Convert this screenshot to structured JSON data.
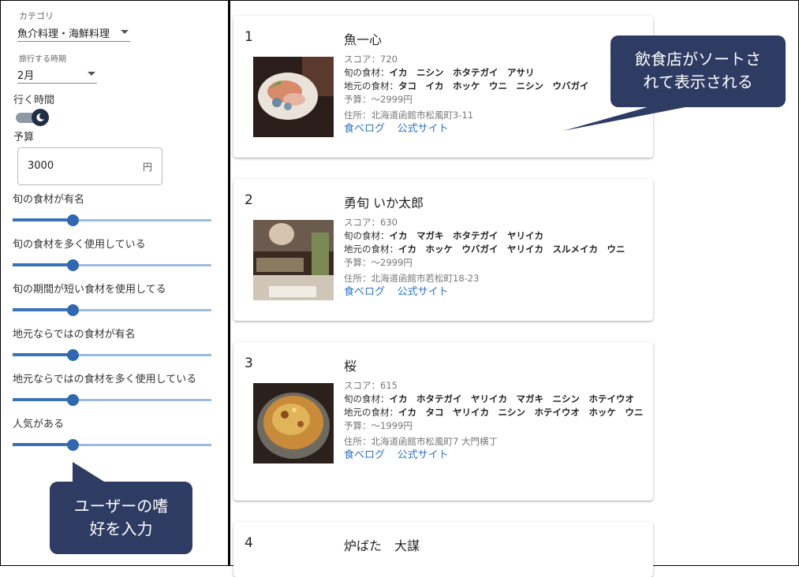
{
  "sidebar": {
    "category_label": "カテゴリ",
    "category_value": "魚介料理・海鮮料理",
    "period_label": "旅行する時期",
    "period_value": "2月",
    "time_label": "行く時間",
    "budget_label": "予算",
    "budget_value": "3000",
    "budget_unit": "円",
    "sliders": [
      {
        "label": "旬の食材が有名",
        "value": 0.3
      },
      {
        "label": "旬の食材を多く使用している",
        "value": 0.3
      },
      {
        "label": "旬の期間が短い食材を使用してる",
        "value": 0.3
      },
      {
        "label": "地元ならではの食材が有名",
        "value": 0.3
      },
      {
        "label": "地元ならではの食材を多く使用している",
        "value": 0.3
      },
      {
        "label": "人気がある",
        "value": 0.3
      }
    ]
  },
  "callouts": {
    "results": "飲食店がソートさ\nれて表示される",
    "input": "ユーザーの嗜\n好を入力"
  },
  "results": [
    {
      "rank": "1",
      "name": "魚一心",
      "score": "スコア：720",
      "seasonal_label": "旬の食材：",
      "seasonal": "イカ　ニシン　ホタテガイ　アサリ",
      "local_label": "地元の食材：",
      "local": "タコ　イカ　ホッケ　ウニ　ニシン　ウバガイ",
      "budget": "予算：～2999円",
      "address": "住所：北海道函館市松風町3-11",
      "link1": "食べログ",
      "link2": "公式サイト"
    },
    {
      "rank": "2",
      "name": "勇旬 いか太郎",
      "score": "スコア：630",
      "seasonal_label": "旬の食材：",
      "seasonal": "イカ　マガキ　ホタテガイ　ヤリイカ",
      "local_label": "地元の食材：",
      "local": "イカ　ホッケ　ウバガイ　ヤリイカ　スルメイカ　ウニ",
      "budget": "予算：～2999円",
      "address": "住所：北海道函館市若松町18-23",
      "link1": "食べログ",
      "link2": "公式サイト"
    },
    {
      "rank": "3",
      "name": "桜",
      "score": "スコア：615",
      "seasonal_label": "旬の食材：",
      "seasonal": "イカ　ホタテガイ　ヤリイカ　マガキ　ニシン　ホテイウオ",
      "local_label": "地元の食材：",
      "local": "イカ　タコ　ヤリイカ　ニシン　ホテイウオ　ホッケ　ウニ",
      "budget": "予算：～1999円",
      "address": "住所：北海道函館市松風町7 大門横丁",
      "link1": "食べログ",
      "link2": "公式サイト"
    },
    {
      "rank": "4",
      "name": "炉ばた　大謀"
    }
  ]
}
